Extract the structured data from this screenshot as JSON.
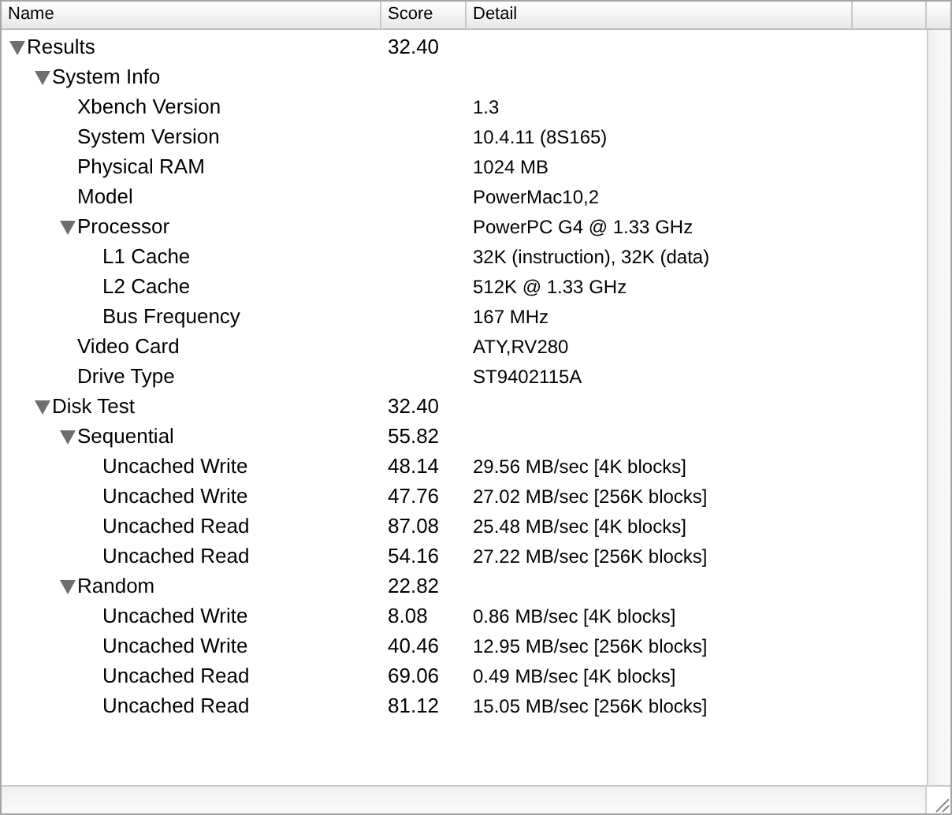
{
  "columns": [
    "Name",
    "Score",
    "Detail"
  ],
  "tree": [
    {
      "name": "Results",
      "score": "32.40",
      "expanded": true,
      "children": [
        {
          "name": "System Info",
          "expanded": true,
          "children": [
            {
              "name": "Xbench Version",
              "detail": "1.3"
            },
            {
              "name": "System Version",
              "detail": "10.4.11 (8S165)"
            },
            {
              "name": "Physical RAM",
              "detail": "1024 MB"
            },
            {
              "name": "Model",
              "detail": "PowerMac10,2"
            },
            {
              "name": "Processor",
              "detail": "PowerPC G4 @ 1.33 GHz",
              "expanded": true,
              "children": [
                {
                  "name": "L1 Cache",
                  "detail": "32K (instruction), 32K (data)"
                },
                {
                  "name": "L2 Cache",
                  "detail": "512K @ 1.33 GHz"
                },
                {
                  "name": "Bus Frequency",
                  "detail": "167 MHz"
                }
              ]
            },
            {
              "name": "Video Card",
              "detail": "ATY,RV280"
            },
            {
              "name": "Drive Type",
              "detail": "ST9402115A"
            }
          ]
        },
        {
          "name": "Disk Test",
          "score": "32.40",
          "expanded": true,
          "children": [
            {
              "name": "Sequential",
              "score": "55.82",
              "expanded": true,
              "children": [
                {
                  "name": "Uncached Write",
                  "score": "48.14",
                  "detail": "29.56 MB/sec [4K blocks]"
                },
                {
                  "name": "Uncached Write",
                  "score": "47.76",
                  "detail": "27.02 MB/sec [256K blocks]"
                },
                {
                  "name": "Uncached Read",
                  "score": "87.08",
                  "detail": "25.48 MB/sec [4K blocks]"
                },
                {
                  "name": "Uncached Read",
                  "score": "54.16",
                  "detail": "27.22 MB/sec [256K blocks]"
                }
              ]
            },
            {
              "name": "Random",
              "score": "22.82",
              "expanded": true,
              "children": [
                {
                  "name": "Uncached Write",
                  "score": "8.08",
                  "detail": "0.86 MB/sec [4K blocks]"
                },
                {
                  "name": "Uncached Write",
                  "score": "40.46",
                  "detail": "12.95 MB/sec [256K blocks]"
                },
                {
                  "name": "Uncached Read",
                  "score": "69.06",
                  "detail": "0.49 MB/sec [4K blocks]"
                },
                {
                  "name": "Uncached Read",
                  "score": "81.12",
                  "detail": "15.05 MB/sec [256K blocks]"
                }
              ]
            }
          ]
        }
      ]
    }
  ]
}
